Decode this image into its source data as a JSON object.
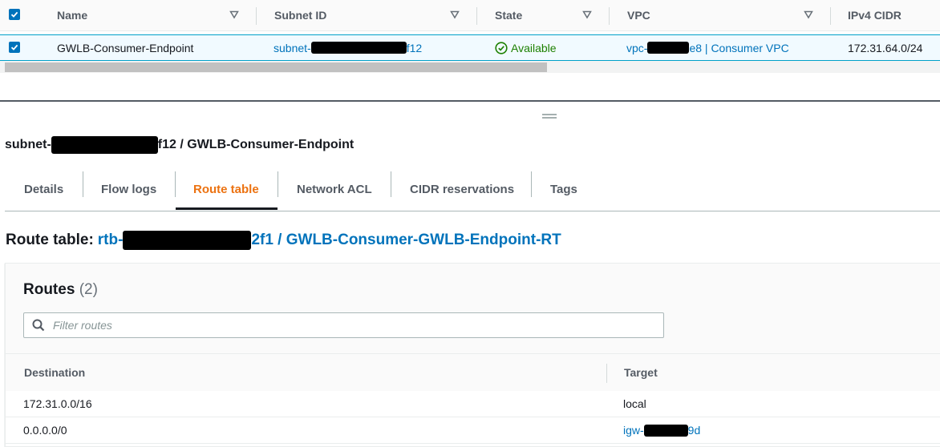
{
  "subnets_table": {
    "columns": [
      {
        "label": "Name"
      },
      {
        "label": "Subnet ID"
      },
      {
        "label": "State"
      },
      {
        "label": "VPC"
      },
      {
        "label": "IPv4 CIDR"
      }
    ],
    "row": {
      "name": "GWLB-Consumer-Endpoint",
      "subnet_id_prefix": "subnet-",
      "subnet_id_suffix": "f12",
      "state": "Available",
      "vpc_prefix": "vpc-",
      "vpc_suffix": "e8 | Consumer VPC",
      "ipv4_cidr": "172.31.64.0/24"
    }
  },
  "detail": {
    "title_prefix": "subnet-",
    "title_suffix": "f12 / GWLB-Consumer-Endpoint",
    "tabs": [
      {
        "label": "Details"
      },
      {
        "label": "Flow logs"
      },
      {
        "label": "Route table",
        "active": true
      },
      {
        "label": "Network ACL"
      },
      {
        "label": "CIDR reservations"
      },
      {
        "label": "Tags"
      }
    ],
    "route_table": {
      "label": "Route table:",
      "id_prefix": "rtb-",
      "id_suffix": "2f1 / GWLB-Consumer-GWLB-Endpoint-RT"
    },
    "routes": {
      "heading": "Routes",
      "count": "(2)",
      "filter_placeholder": "Filter routes",
      "columns": {
        "destination": "Destination",
        "target": "Target"
      },
      "rows": [
        {
          "destination": "172.31.0.0/16",
          "target": "local"
        },
        {
          "destination": "0.0.0.0/0",
          "target_prefix": "igw-",
          "target_suffix": "9d"
        }
      ]
    }
  },
  "colors": {
    "link": "#0073bb",
    "active_tab": "#ec7211",
    "status_ok": "#1d8102",
    "selection": "#f1faff"
  },
  "icons": [
    "checkbox-checked-icon",
    "sort-icon",
    "status-available-icon",
    "drag-handle-icon",
    "search-icon"
  ]
}
